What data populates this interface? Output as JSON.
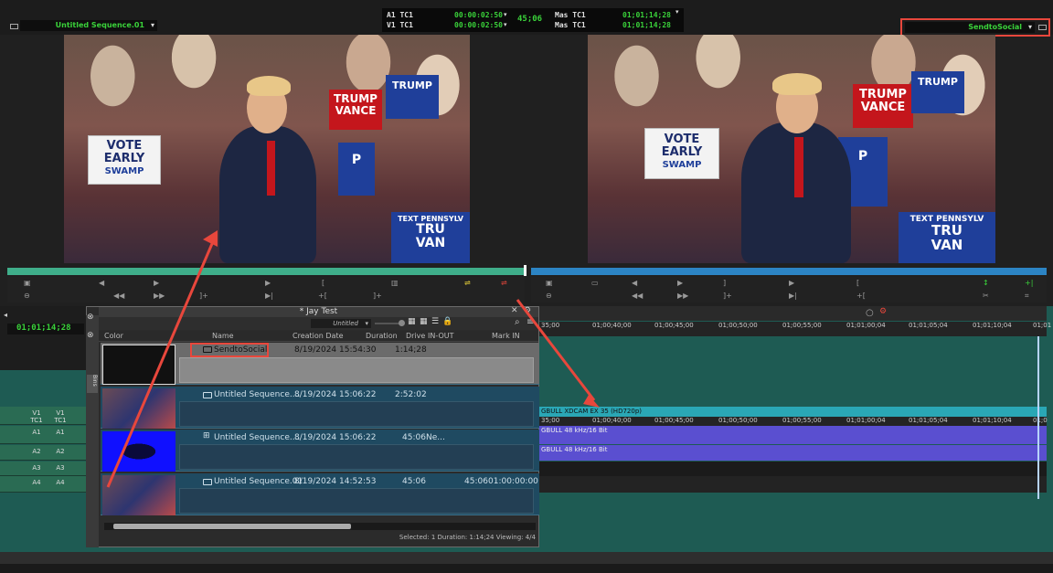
{
  "top": {
    "left_sequence": "Untitled Sequence.01",
    "right_sequence": "SendtoSocial",
    "tc": [
      {
        "label": "A1  TC1",
        "value": "00:00:02:50"
      },
      {
        "label": "V1  TC1",
        "value": "00:00:02:50"
      }
    ],
    "tc_center": "45;06",
    "mas": [
      {
        "label": "Mas  TC1",
        "value": "01;01;14;28"
      },
      {
        "label": "Mas  TC1",
        "value": "01;01;14;28"
      }
    ]
  },
  "left_frame": {
    "signs": [
      "TRUMP\nVANCE",
      "VOTE EARLY",
      "SWAMP",
      "TEXT PENNSYLV",
      "TRU\nVAN"
    ]
  },
  "right_frame": {
    "signs": [
      "TRUMP\nVANCE",
      "VOTE EARLY",
      "SWAMP",
      "TEXT PENNSYLV",
      "TRU\nVAN"
    ]
  },
  "timeline": {
    "timecode": "01;01;14;28",
    "ruler": [
      "35;00",
      "01;00;40;00",
      "01;00;45;00",
      "01;00;50;00",
      "01;00;55;00",
      "01;01;00;04",
      "01;01;05;04",
      "01;01;10;04",
      "01;01"
    ],
    "ruler2": [
      "35;00",
      "01;00;40;00",
      "01;00;45;00",
      "01;00;50;00",
      "01;00;55;00",
      "01;01;00;04",
      "01;01;05;04",
      "01;01;10;04",
      "01;0"
    ],
    "video_clip": "GBULL XDCAM EX 35 (HD720p)",
    "audio_clip1": "GBULL 48 kHz/16 Bit",
    "audio_clip2": "GBULL 48 kHz/16 Bit",
    "tracks": [
      {
        "a": "V1",
        "b": "V1"
      },
      {
        "a": "TC1",
        "b": "TC1"
      },
      {
        "a": "A1",
        "b": "A1"
      },
      {
        "a": "A2",
        "b": "A2"
      },
      {
        "a": "A3",
        "b": "A3"
      },
      {
        "a": "A4",
        "b": "A4"
      }
    ]
  },
  "bin": {
    "title": "* Jay Test",
    "view": "Untitled",
    "columns": [
      "Color",
      "Name",
      "Creation Date",
      "Duration",
      "Drive",
      "IN-OUT",
      "Mark IN"
    ],
    "rows": [
      {
        "name": "SendtoSocial",
        "date": "8/19/2024 15:54:30",
        "duration": "1:14;28",
        "inout": "",
        "markin": ""
      },
      {
        "name": "Untitled Sequence....",
        "date": "8/19/2024 15:06:22",
        "duration": "2:52:02",
        "inout": "",
        "markin": ""
      },
      {
        "name": "Untitled Sequence....",
        "date": "8/19/2024 15:06:22",
        "duration": "45:06",
        "inout": "Ne...",
        "markin": ""
      },
      {
        "name": "Untitled Sequence.01",
        "date": "8/19/2024 14:52:53",
        "duration": "45:06",
        "inout": "45:06",
        "markin": "01:00:00:00"
      }
    ],
    "status": "Selected: 1  Duration: 1:14;24  Viewing: 4/4",
    "side_tab": "Bins"
  },
  "colors": {
    "accent_green": "#3ad23a",
    "highlight_red": "#e8473c",
    "bin_row": "#1f4a61",
    "timeline_teal": "#1e5b53",
    "audio_purple": "#5a4fd0"
  }
}
